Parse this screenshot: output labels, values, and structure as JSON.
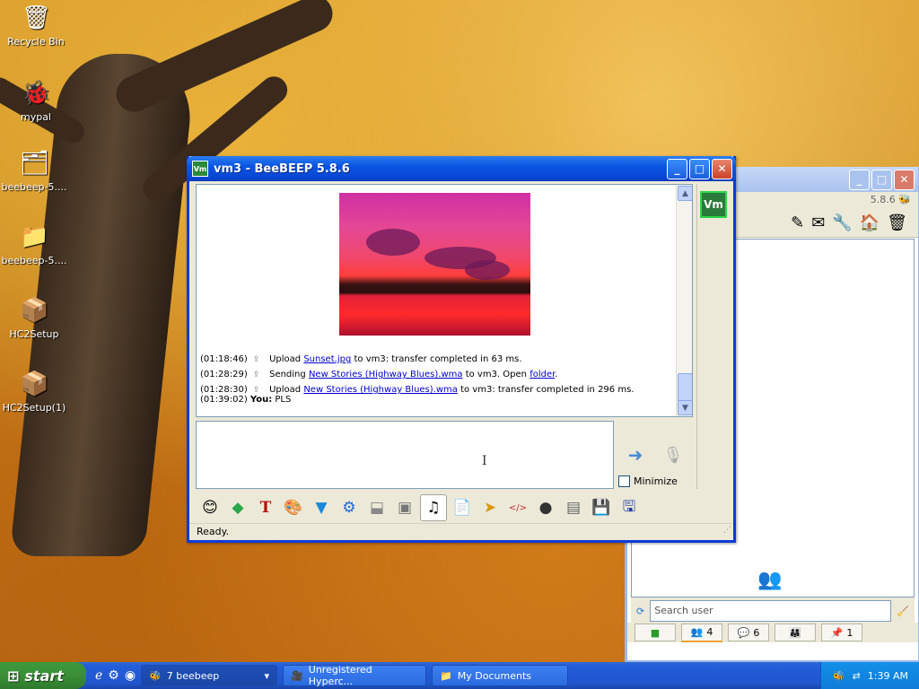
{
  "desktop": {
    "icons": [
      {
        "label": "Recycle Bin",
        "icon": "recycle-bin-icon"
      },
      {
        "label": "mypal",
        "icon": "mypal-icon"
      },
      {
        "label": "beebeep-5....",
        "icon": "zip-folder-icon"
      },
      {
        "label": "beebeep-5....",
        "icon": "folder-icon"
      },
      {
        "label": "HC2Setup",
        "icon": "installer-icon"
      },
      {
        "label": "HC2Setup(1)",
        "icon": "installer-icon"
      }
    ]
  },
  "main_window": {
    "title": "vm3 - BeeBEEP 5.8.6",
    "app_badge": "Vm",
    "messages": [
      {
        "time": "(01:18:46)",
        "pre": "Upload",
        "link": "Sunset.jpg",
        "post": "to vm3: transfer completed in 63 ms."
      },
      {
        "time": "(01:28:29)",
        "pre": "Sending",
        "link": "New Stories (Highway Blues).wma",
        "post": "to vm3. Open",
        "link2": "folder",
        "post2": "."
      },
      {
        "time": "(01:28:30)",
        "pre": "Upload",
        "link": "New Stories (Highway Blues).wma",
        "post": "to vm3: transfer completed in 296 ms."
      },
      {
        "time": "(01:39:02)",
        "sender": "You:",
        "text": "PLS"
      }
    ],
    "minimize_label": "Minimize",
    "status": "Ready.",
    "toolbar_icons": [
      "emoticon-icon",
      "layer-icon",
      "font-icon",
      "color-picker-icon",
      "filter-icon",
      "settings-icon",
      "inbox-icon",
      "book-icon",
      "music-file-icon",
      "send-file-icon",
      "folder-share-icon",
      "html-icon",
      "screenshot-icon",
      "window-icon",
      "save-icon",
      "floppy-icon"
    ]
  },
  "back_window": {
    "version": "5.8.6",
    "search_placeholder": "Search user",
    "tabs": [
      {
        "icon": "chat-icon",
        "count": ""
      },
      {
        "icon": "users-icon",
        "count": "4"
      },
      {
        "icon": "chats-icon",
        "count": "6"
      },
      {
        "icon": "groups-icon",
        "count": ""
      },
      {
        "icon": "share-icon",
        "count": "1"
      }
    ]
  },
  "taskbar": {
    "start_label": "start",
    "tasks": [
      {
        "label": "7 beebeep",
        "icon": "beebeep-icon"
      },
      {
        "label": "Unregistered Hyperc...",
        "icon": "hypercam-icon"
      },
      {
        "label": "My Documents",
        "icon": "folder-icon"
      }
    ],
    "clock": "1:39 AM"
  }
}
